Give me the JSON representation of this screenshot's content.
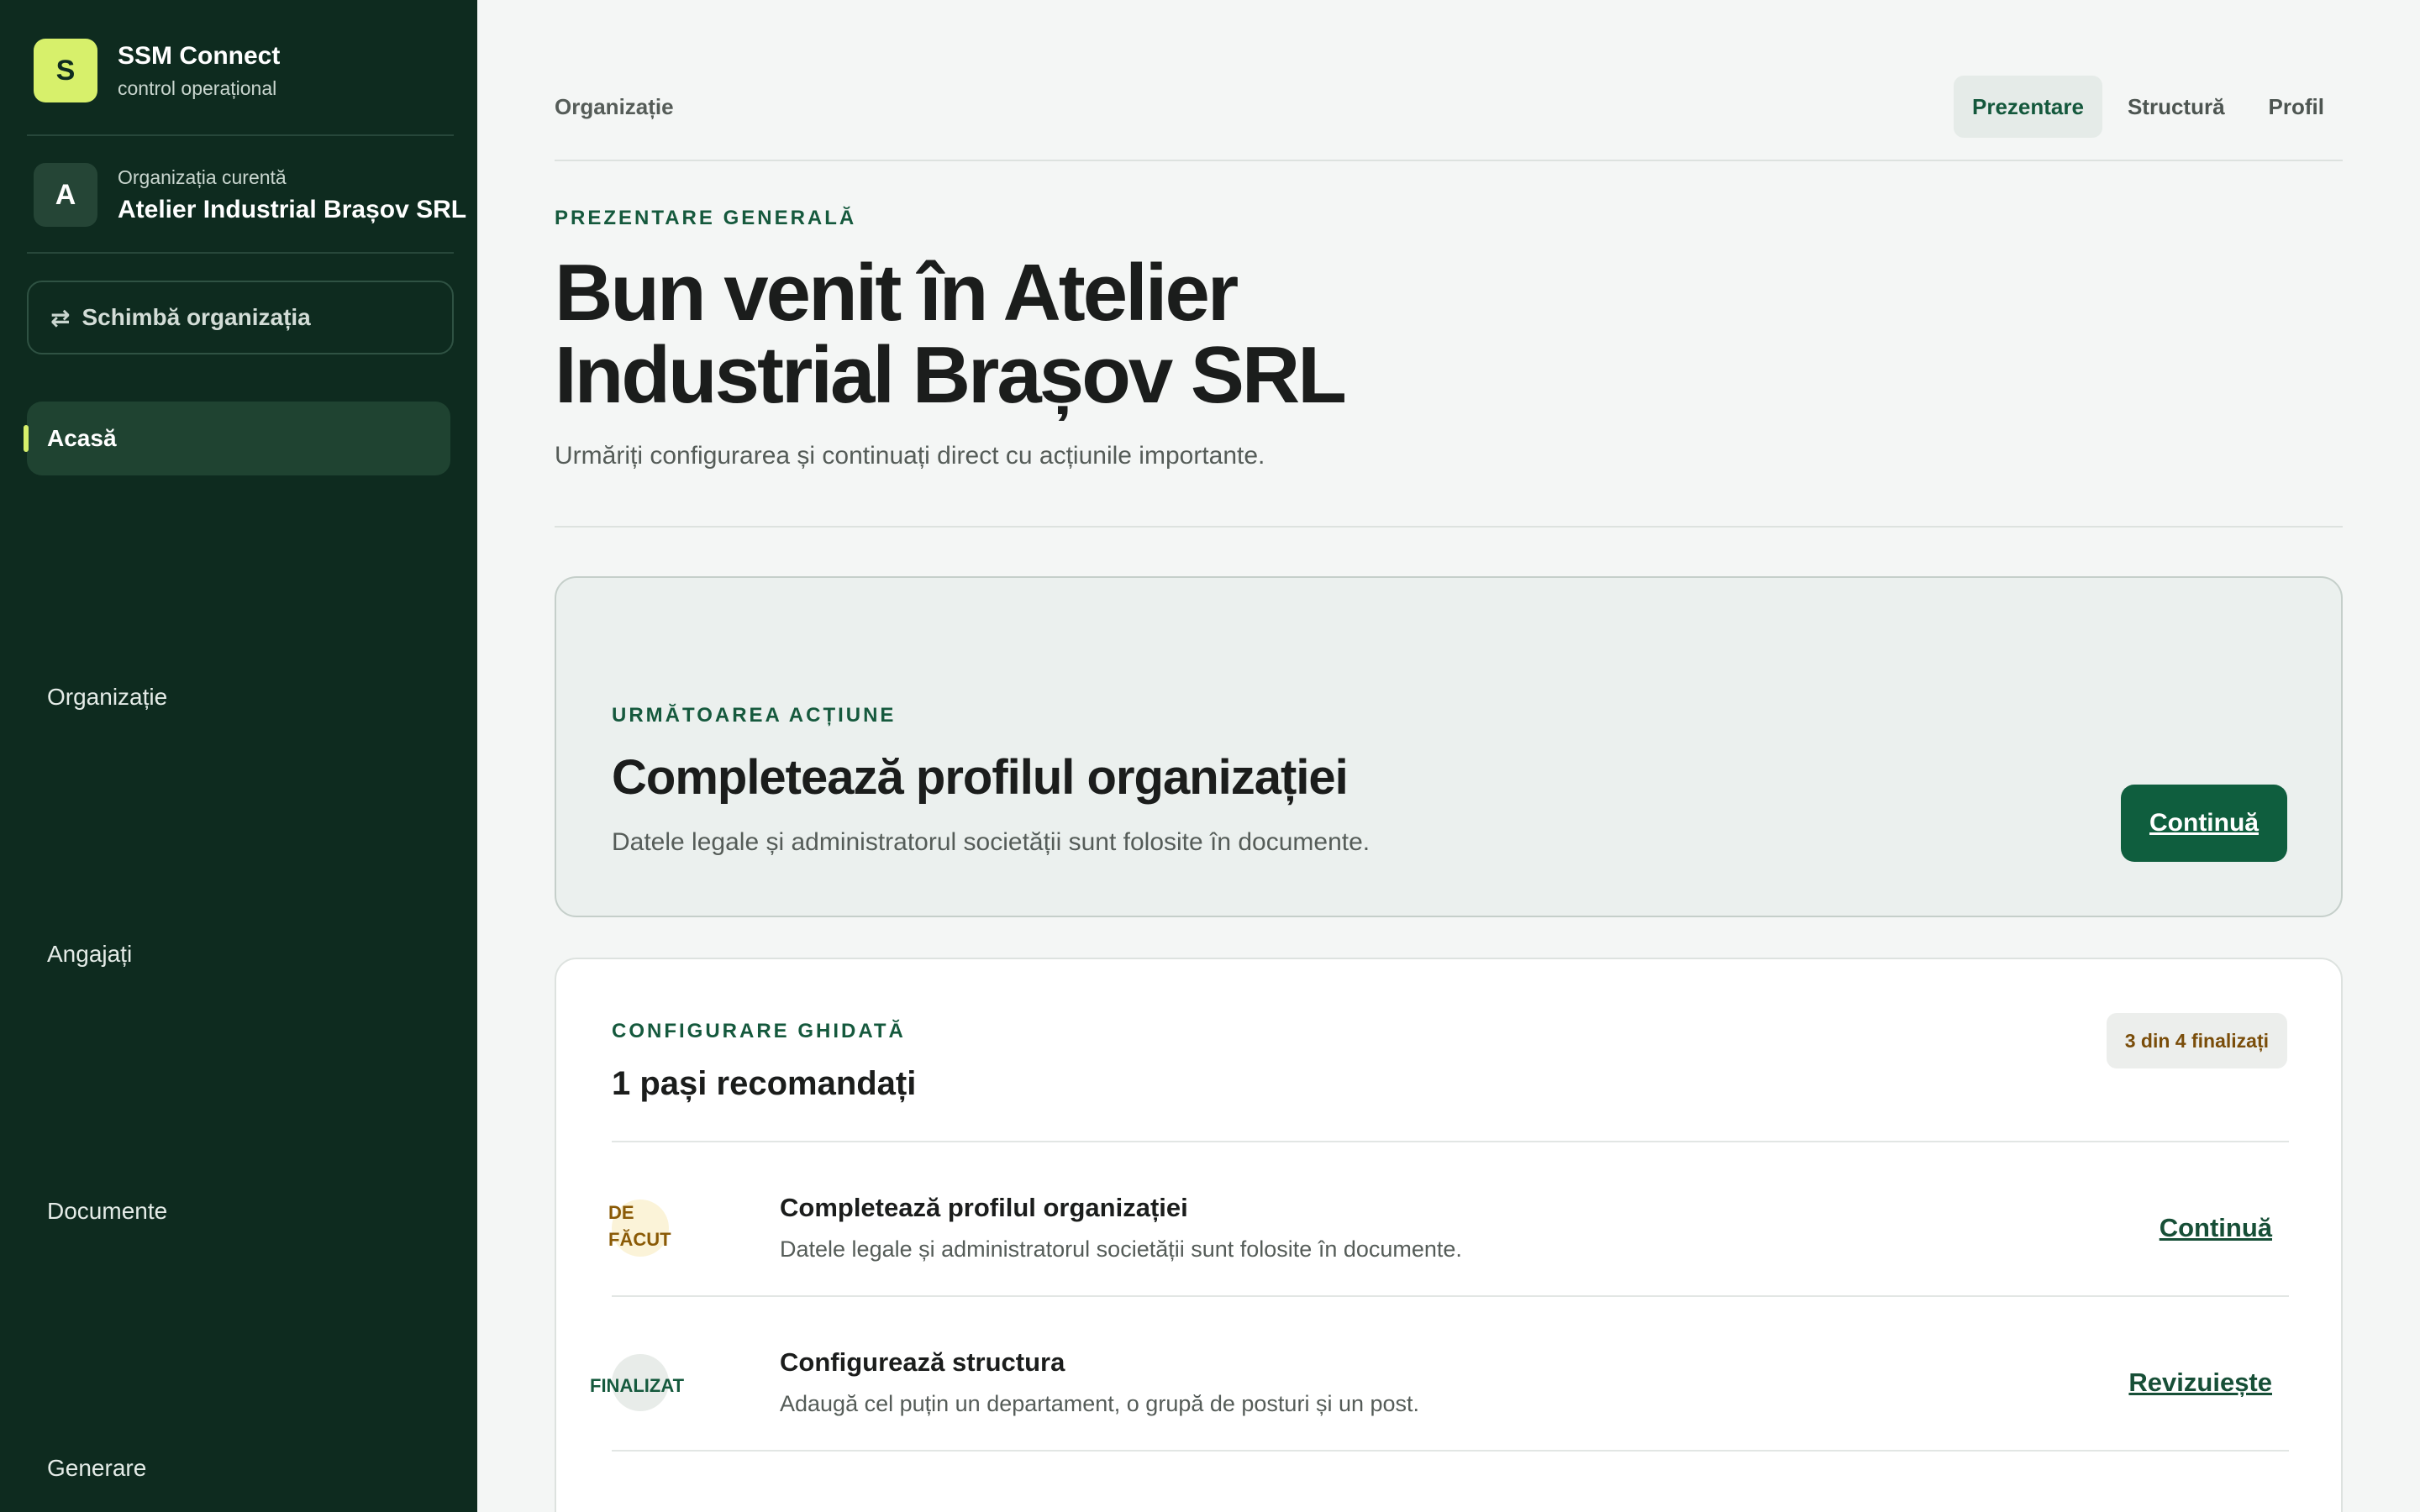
{
  "brand": {
    "logo_letter": "S",
    "name": "SSM Connect",
    "subtitle": "control operațional"
  },
  "organization": {
    "avatar_letter": "A",
    "label": "Organizația curentă",
    "name": "Atelier Industrial Brașov SRL",
    "switch_label": "Schimbă organizația",
    "switch_icon": "swap-arrows-icon"
  },
  "sidebar": {
    "items": [
      {
        "label": "Acasă",
        "active": true
      },
      {
        "label": "Organizație",
        "active": false
      },
      {
        "label": "Angajați",
        "active": false
      },
      {
        "label": "Documente",
        "active": false
      },
      {
        "label": "Generare",
        "active": false
      }
    ]
  },
  "header": {
    "breadcrumb": "Organizație",
    "tabs": [
      {
        "label": "Prezentare",
        "active": true
      },
      {
        "label": "Structură",
        "active": false
      },
      {
        "label": "Profil",
        "active": false
      }
    ]
  },
  "hero": {
    "eyebrow": "PREZENTARE GENERALĂ",
    "title": "Bun venit în Atelier Industrial Brașov SRL",
    "subtitle": "Urmăriți configurarea și continuați direct cu acțiunile importante."
  },
  "next_action": {
    "eyebrow": "URMĂTOAREA ACȚIUNE",
    "title": "Completează profilul organizației",
    "description": "Datele legale și administratorul societății sunt folosite în documente.",
    "button_label": "Continuă"
  },
  "setup": {
    "eyebrow": "CONFIGURARE GHIDATĂ",
    "title": "1 pași recomandați",
    "progress_label": "3 din 4 finalizați",
    "steps": [
      {
        "status": "DE FĂCUT",
        "title": "Completează profilul organizației",
        "description": "Datele legale și administratorul societății sunt folosite în documente.",
        "action": "Continuă"
      },
      {
        "status": "FINALIZAT",
        "title": "Configurează structura",
        "description": "Adaugă cel puțin un departament, o grupă de posturi și un post.",
        "action": "Revizuiește"
      }
    ]
  },
  "colors": {
    "sidebar_bg": "#0e2b1f",
    "accent_lime": "#d7f06b",
    "primary_green": "#0f5e3e",
    "page_bg": "#f4f6f5"
  }
}
